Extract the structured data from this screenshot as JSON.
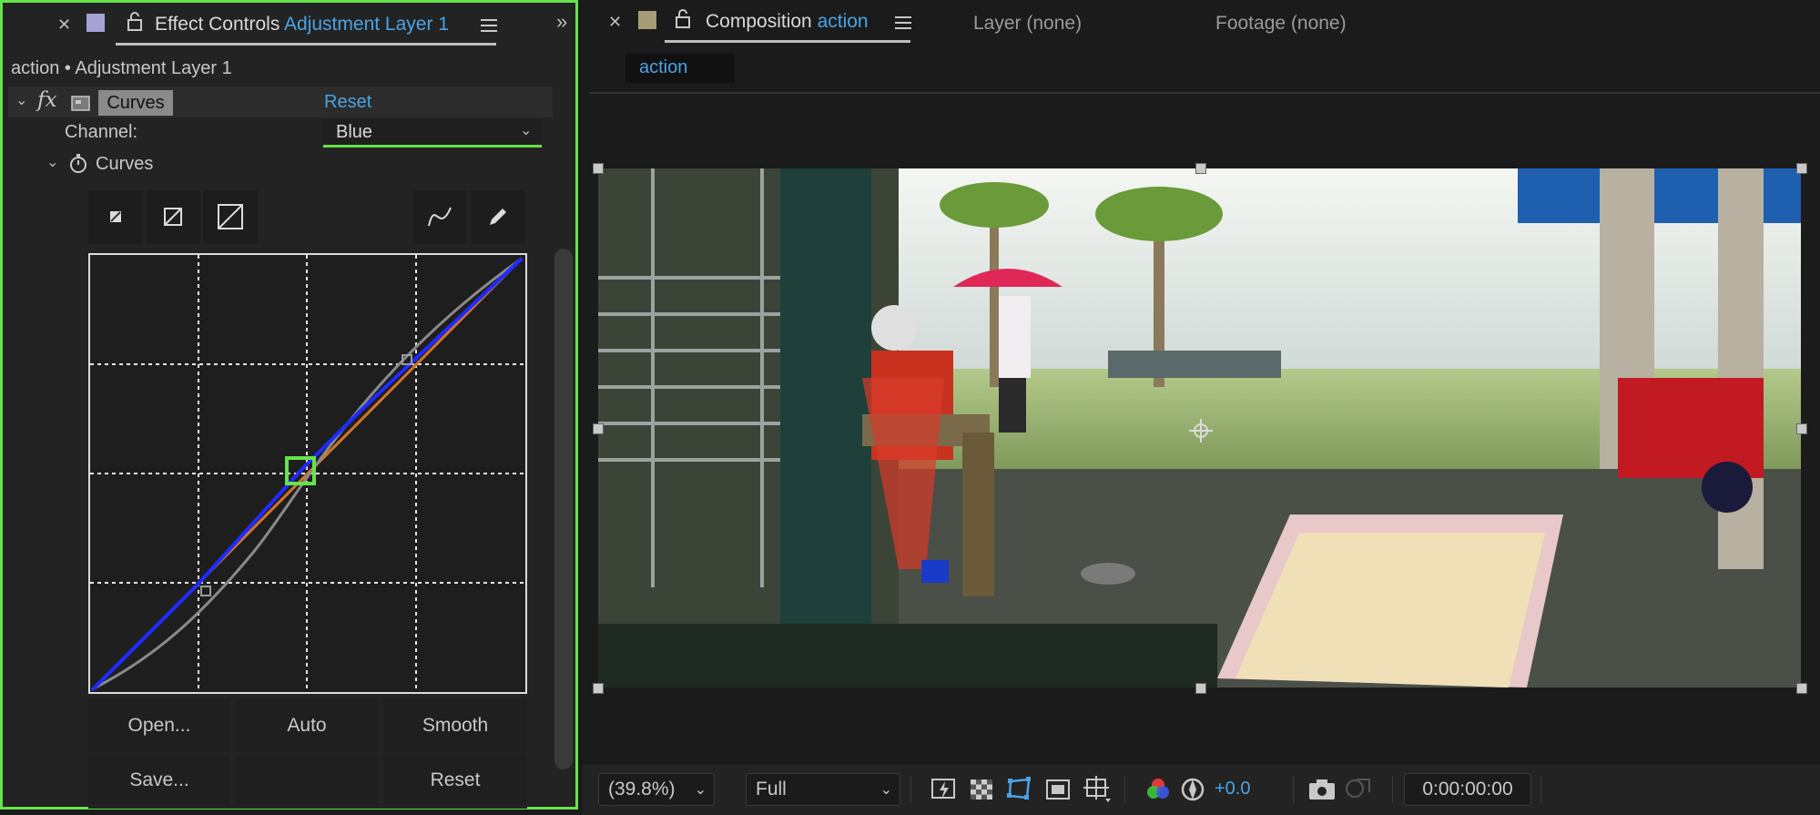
{
  "effect_controls": {
    "tab_title": "Effect Controls",
    "layer_name": "Adjustment Layer 1",
    "breadcrumb": "action • Adjustment Layer 1",
    "effect": {
      "fx_label": "fx",
      "name": "Curves",
      "reset": "Reset",
      "channel_label": "Channel:",
      "channel_value": "Blue",
      "property_label": "Curves"
    },
    "buttons": {
      "open": "Open...",
      "auto": "Auto",
      "smooth": "Smooth",
      "save": "Save...",
      "reset": "Reset"
    }
  },
  "composition": {
    "tab_title": "Composition",
    "comp_name": "action",
    "layer_tab": "Layer (none)",
    "footage_tab": "Footage (none)",
    "sub_tab": "action",
    "zoom": "(39.8%)",
    "resolution": "Full",
    "exposure": "+0.0",
    "timecode": "0:00:00:00"
  },
  "colors": {
    "accent": "#4ba3e6",
    "highlight": "#66e34a",
    "curve_blue": "#1f2bff",
    "curve_orange": "#d2742a",
    "curve_gray": "#8a8a8a"
  }
}
